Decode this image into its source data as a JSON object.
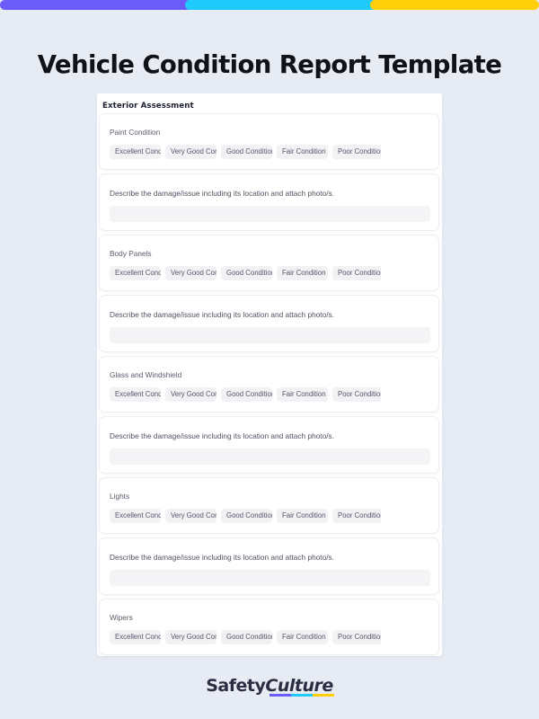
{
  "topbar": {
    "segments": [
      {
        "name": "purple",
        "color": "#6c5cf7"
      },
      {
        "name": "cyan",
        "color": "#1ecbfb"
      },
      {
        "name": "yellow",
        "color": "#ffd00a"
      }
    ]
  },
  "header": {
    "title": "Vehicle Condition Report Template"
  },
  "report": {
    "section_title": "Exterior Assessment",
    "describe_label": "Describe the damage/issue including its location and attach photo/s.",
    "describe_value": "",
    "describe_placeholder": "",
    "options": [
      "Excellent Condition",
      "Very Good Condition",
      "Good Condition",
      "Fair Condition",
      "Poor Condition"
    ],
    "items": [
      {
        "label": "Paint Condition",
        "has_describe": true
      },
      {
        "label": "Body Panels",
        "has_describe": true
      },
      {
        "label": "Glass and Windshield",
        "has_describe": true
      },
      {
        "label": "Lights",
        "has_describe": true
      },
      {
        "label": "Wipers",
        "has_describe": false
      }
    ]
  },
  "footer": {
    "brand_first": "Safety",
    "brand_second": "Culture",
    "underline_colors": [
      "#6c5cf7",
      "#1ecbfb",
      "#ffd00a"
    ]
  }
}
